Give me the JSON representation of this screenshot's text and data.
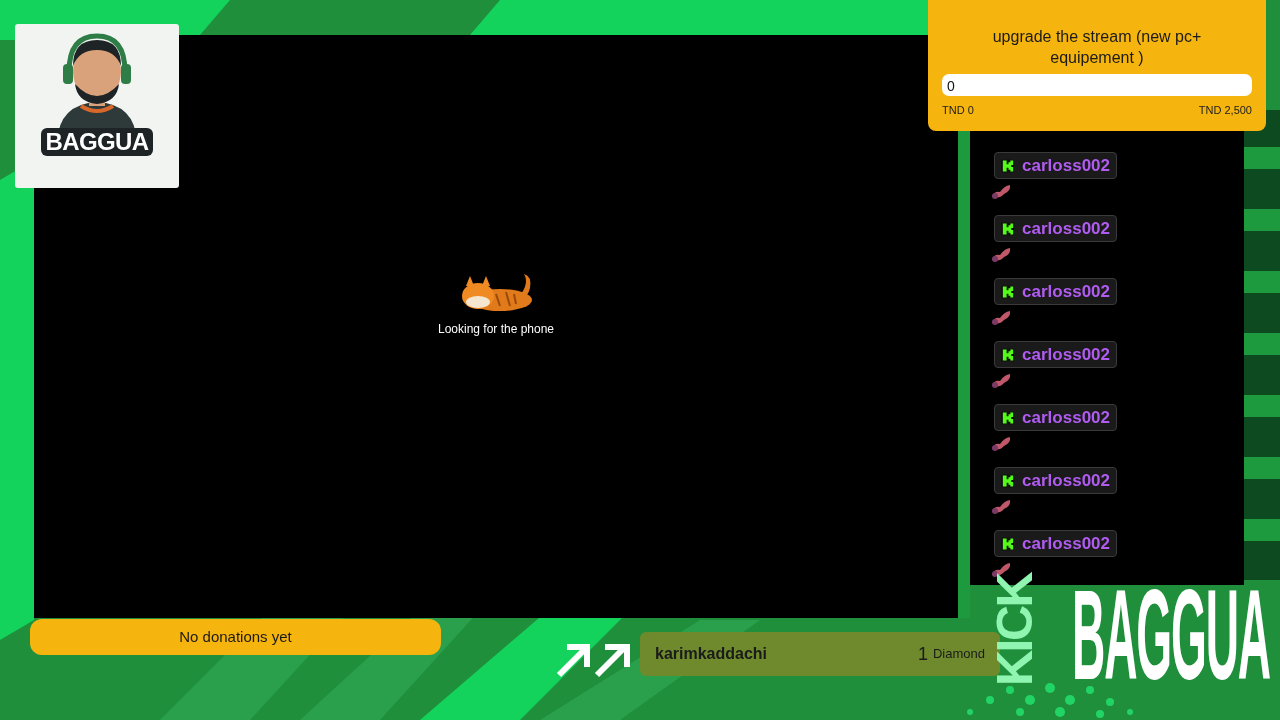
{
  "logo_card": {
    "label": "BAGGUA"
  },
  "video": {
    "caption": "Looking for the phone"
  },
  "goal": {
    "title": "upgrade the stream (new pc+ equipement )",
    "value": "0",
    "level": 0,
    "min_label": "TND 0",
    "max_label": "TND 2,500"
  },
  "chat": {
    "messages": [
      {
        "kind": "kick",
        "username": "carloss002"
      },
      {
        "kind": "kick",
        "username": "carloss002"
      },
      {
        "kind": "kick",
        "username": "carloss002"
      },
      {
        "kind": "kick",
        "username": "carloss002"
      },
      {
        "kind": "kick",
        "username": "carloss002"
      },
      {
        "kind": "kick",
        "username": "carloss002"
      },
      {
        "kind": "kick",
        "username": "carloss002"
      }
    ]
  },
  "donations": {
    "text": "No donations yet"
  },
  "alert": {
    "username": "karimkaddachi",
    "amount": "1",
    "unit": "Diamond"
  },
  "brand": {
    "platform": "KICK",
    "name": "BAGGUA"
  }
}
